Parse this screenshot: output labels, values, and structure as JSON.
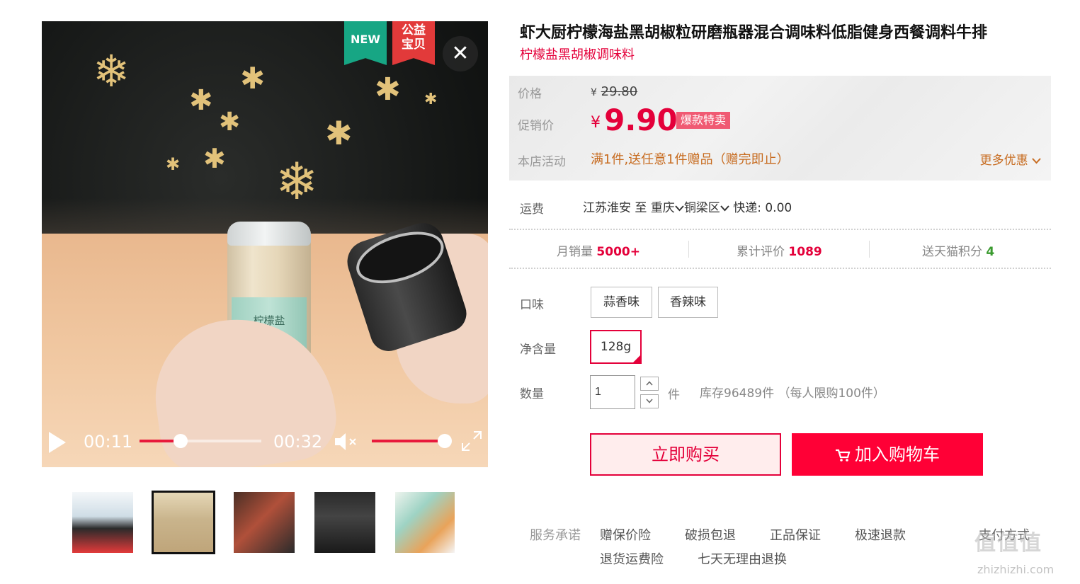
{
  "video": {
    "badge_new": "NEW",
    "badge_charity_line1": "公益",
    "badge_charity_line2": "宝贝",
    "close_glyph": "✕",
    "current_time": "00:11",
    "duration": "00:32",
    "progress_fraction": 0.34,
    "volume_fraction": 1.0,
    "jar_label_text": "柠檬盐"
  },
  "thumbnails": [
    {
      "name": "thumbnail-1",
      "active": false,
      "color": "#dfe8ef"
    },
    {
      "name": "thumbnail-2",
      "active": true,
      "color": "#d7c7a8"
    },
    {
      "name": "thumbnail-3",
      "active": false,
      "color": "#3a2a24"
    },
    {
      "name": "thumbnail-4",
      "active": false,
      "color": "#1f1f1f"
    },
    {
      "name": "thumbnail-5",
      "active": false,
      "color": "#e8efe8"
    }
  ],
  "product": {
    "title": "虾大厨柠檬海盐黑胡椒粒研磨瓶器混合调味料低脂健身西餐调料牛排",
    "subtitle": "柠檬盐黑胡椒调味料"
  },
  "price": {
    "label": "价格",
    "currency": "¥",
    "original": "29.80",
    "promo_label": "促销价",
    "promo": "9.90",
    "hot_tag": "爆款特卖",
    "activity_label": "本店活动",
    "activity": "满1件,送任意1件赠品（赠完即止）",
    "more_deals": "更多优惠"
  },
  "shipping": {
    "label": "运费",
    "from": "江苏淮安",
    "to_word": "至",
    "province": "重庆",
    "district": "铜梁区",
    "method": "快递: 0.00"
  },
  "stats": {
    "monthly_sales_label": "月销量",
    "monthly_sales": "5000+",
    "reviews_label": "累计评价",
    "reviews": "1089",
    "points_label": "送天猫积分",
    "points": "4"
  },
  "options": {
    "flavor_label": "口味",
    "flavors": [
      "蒜香味",
      "香辣味"
    ],
    "weight_label": "净含量",
    "weight": "128g",
    "quantity_label": "数量",
    "quantity": "1",
    "unit": "件",
    "stock": "库存96489件 （每人限购100件）"
  },
  "actions": {
    "buy_now": "立即购买",
    "add_to_cart": "加入购物车"
  },
  "services": {
    "label": "服务承诺",
    "items": [
      "赠保价险",
      "破损包退",
      "正品保证",
      "极速退款",
      "退货运费险",
      "七天无理由退换"
    ],
    "partial": "支付方式"
  },
  "watermark": {
    "text": "值值值",
    "url": "zhizhizhi.com"
  },
  "colors": {
    "accent": "#e4003a",
    "cart_button": "#ff0036",
    "activity": "#c76b1f",
    "points": "#3a9a2e"
  }
}
